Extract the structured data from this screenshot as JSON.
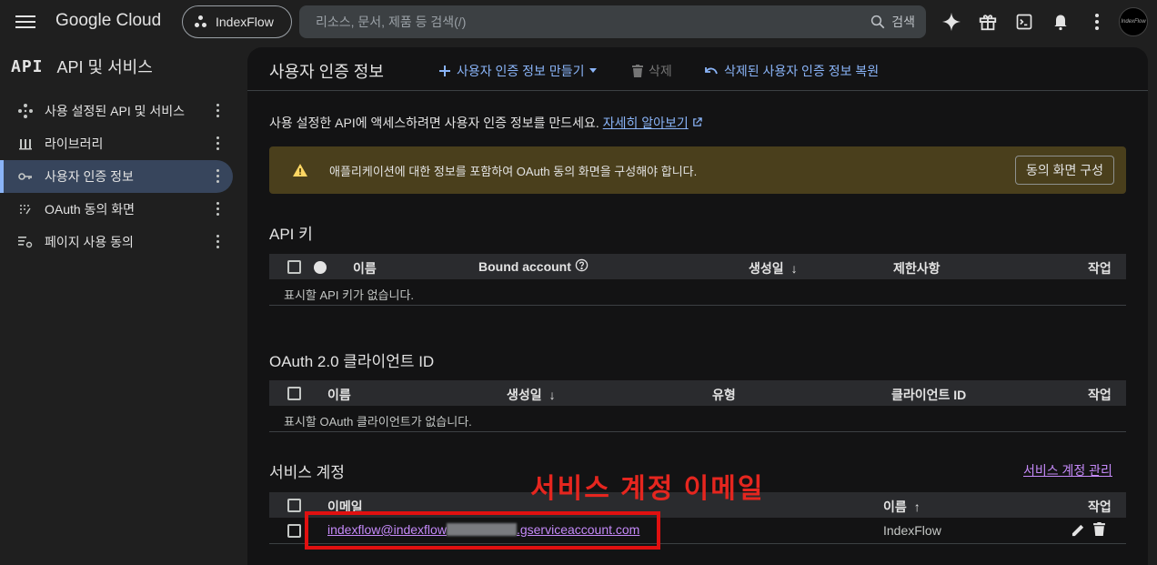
{
  "topbar": {
    "brand": "Google Cloud",
    "project": "IndexFlow",
    "search_placeholder": "리소스, 문서, 제품 등 검색(/)",
    "search_button": "검색",
    "avatar_text": "IndexFlow"
  },
  "sidebar": {
    "logo": "API",
    "title": "API 및 서비스",
    "items": [
      {
        "label": "사용 설정된 API 및 서비스",
        "icon": "diamond-dots-icon"
      },
      {
        "label": "라이브러리",
        "icon": "library-icon"
      },
      {
        "label": "사용자 인증 정보",
        "icon": "key-icon",
        "active": true
      },
      {
        "label": "OAuth 동의 화면",
        "icon": "consent-dots-icon"
      },
      {
        "label": "페이지 사용 동의",
        "icon": "list-settings-icon"
      }
    ]
  },
  "main": {
    "title": "사용자 인증 정보",
    "create_label": "사용자 인증 정보 만들기",
    "delete_label": "삭제",
    "restore_label": "삭제된 사용자 인증 정보 복원",
    "intro_text": "사용 설정한 API에 액세스하려면 사용자 인증 정보를 만드세요.",
    "intro_link": "자세히 알아보기",
    "banner_text": "애플리케이션에 대한 정보를 포함하여 OAuth 동의 화면을 구성해야 합니다.",
    "banner_button": "동의 화면 구성"
  },
  "api_keys": {
    "title": "API 키",
    "columns": [
      "이름",
      "Bound account",
      "생성일",
      "제한사항",
      "작업"
    ],
    "empty": "표시할 API 키가 없습니다."
  },
  "oauth": {
    "title": "OAuth 2.0 클라이언트 ID",
    "columns": [
      "이름",
      "생성일",
      "유형",
      "클라이언트 ID",
      "작업"
    ],
    "empty": "표시할 OAuth 클라이언트가 없습니다."
  },
  "service_accounts": {
    "title": "서비스 계정",
    "manage_link": "서비스 계정 관리",
    "columns": [
      "이메일",
      "이름",
      "작업"
    ],
    "rows": [
      {
        "email_prefix": "indexflow@indexflow",
        "email_suffix": ".gserviceaccount.com",
        "name": "IndexFlow"
      }
    ]
  },
  "annotation": "서비스 계정 이메일",
  "colors": {
    "accent": "#8ab4f8",
    "annotation": "#e5261f",
    "link_purple": "#c58af9",
    "banner": "#4a3f1c"
  }
}
